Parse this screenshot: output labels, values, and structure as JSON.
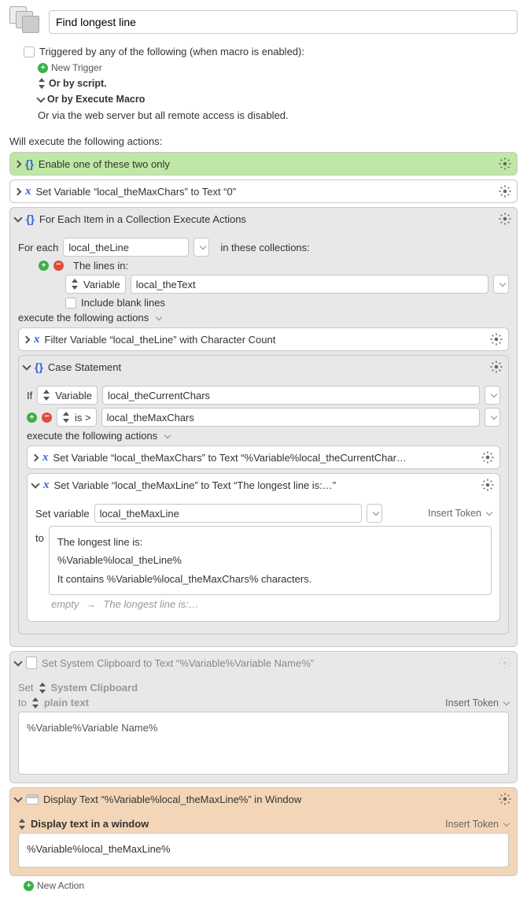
{
  "title": "Find longest line",
  "trigger": {
    "label": "Triggered by any of the following (when macro is enabled):",
    "new_trigger": "New Trigger",
    "or_script": "Or by script.",
    "or_execute": "Or by Execute Macro",
    "web_note": "Or via the web server but all remote access is disabled."
  },
  "exec_label": "Will execute the following actions:",
  "enable_action": "Enable one of these two only",
  "set_max_chars": "Set Variable “local_theMaxChars” to Text “0”",
  "foreach": {
    "title": "For Each Item in a Collection Execute Actions",
    "for_each_label": "For each",
    "var_name": "local_theLine",
    "in_collections": "in these collections:",
    "lines_in": "The lines in:",
    "variable_label": "Variable",
    "text_var": "local_theText",
    "include_blank": "Include blank lines",
    "exec_following": "execute the following actions"
  },
  "filter": "Filter Variable “local_theLine” with Character Count",
  "case": {
    "title": "Case Statement",
    "if_label": "If",
    "variable_label": "Variable",
    "cond_var": "local_theCurrentChars",
    "is_gt": "is >",
    "compare_to": "local_theMaxChars",
    "exec_following": "execute the following actions"
  },
  "set_max_chars2": "Set Variable “local_theMaxChars” to Text “%Variable%local_theCurrentChar…",
  "set_max_line": {
    "title": "Set Variable “local_theMaxLine” to Text “The longest line is:…”",
    "set_var_label": "Set variable",
    "var_name": "local_theMaxLine",
    "insert_token": "Insert Token",
    "to_label": "to",
    "body_line1": "The longest line is:",
    "body_line2": "%Variable%local_theLine%",
    "body_line3": "It contains %Variable%local_theMaxChars% characters.",
    "empty_label": "empty",
    "empty_preview": "The longest line is:…"
  },
  "clipboard": {
    "title": "Set System Clipboard to Text “%Variable%Variable Name%”",
    "set_label": "Set",
    "sys_clip": "System Clipboard",
    "to_label": "to",
    "plain_text": "plain text",
    "insert_token": "Insert Token",
    "body": "%Variable%Variable Name%"
  },
  "display": {
    "title": "Display Text “%Variable%local_theMaxLine%” in Window",
    "mode": "Display text in a window",
    "insert_token": "Insert Token",
    "body": "%Variable%local_theMaxLine%"
  },
  "new_action": "New Action"
}
